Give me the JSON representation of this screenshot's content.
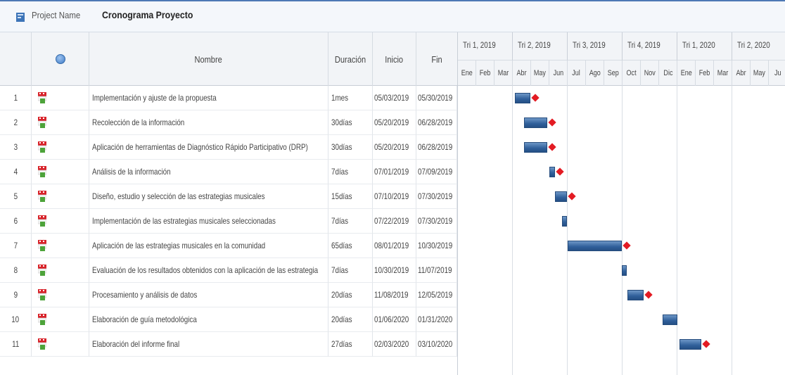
{
  "header": {
    "project_label": "Project Name",
    "project_name": "Cronograma Proyecto"
  },
  "columns": {
    "info": "info",
    "name": "Nombre",
    "duration": "Duración",
    "start": "Inicio",
    "end": "Fin"
  },
  "quarters": [
    "Tri 1, 2019",
    "Tri 2, 2019",
    "Tri 3, 2019",
    "Tri 4, 2019",
    "Tri 1, 2020",
    "Tri 2, 2020"
  ],
  "months": [
    "Ene",
    "Feb",
    "Mar",
    "Abr",
    "May",
    "Jun",
    "Jul",
    "Ago",
    "Sep",
    "Oct",
    "Nov",
    "Dic",
    "Ene",
    "Feb",
    "Mar",
    "Abr",
    "May",
    "Ju"
  ],
  "tasks": [
    {
      "id": "1",
      "name": "Implementación y ajuste de la propuesta",
      "duration": "1mes",
      "start": "05/03/2019",
      "end": "05/30/2019"
    },
    {
      "id": "2",
      "name": "Recolección de la información",
      "duration": "30días",
      "start": "05/20/2019",
      "end": "06/28/2019"
    },
    {
      "id": "3",
      "name": "Aplicación de herramientas de Diagnóstico Rápido Participativo (DRP)",
      "duration": "30días",
      "start": "05/20/2019",
      "end": "06/28/2019"
    },
    {
      "id": "4",
      "name": "Análisis de la información",
      "duration": "7días",
      "start": "07/01/2019",
      "end": "07/09/2019"
    },
    {
      "id": "5",
      "name": "Diseño, estudio y selección de las estrategias musicales",
      "duration": "15días",
      "start": "07/10/2019",
      "end": "07/30/2019"
    },
    {
      "id": "6",
      "name": "Implementación de las estrategias musicales seleccionadas",
      "duration": "7días",
      "start": "07/22/2019",
      "end": "07/30/2019"
    },
    {
      "id": "7",
      "name": "Aplicación de las estrategias musicales en la comunidad",
      "duration": "65días",
      "start": "08/01/2019",
      "end": "10/30/2019"
    },
    {
      "id": "8",
      "name": "Evaluación de los resultados obtenidos con la aplicación de las estrategia",
      "duration": "7días",
      "start": "10/30/2019",
      "end": "11/07/2019"
    },
    {
      "id": "9",
      "name": "Procesamiento y análisis de datos",
      "duration": "20días",
      "start": "11/08/2019",
      "end": "12/05/2019"
    },
    {
      "id": "10",
      "name": "Elaboración de guía metodológica",
      "duration": "20días",
      "start": "01/06/2020",
      "end": "01/31/2020"
    },
    {
      "id": "11",
      "name": "Elaboración del informe final",
      "duration": "27días",
      "start": "02/03/2020",
      "end": "03/10/2020"
    }
  ],
  "bars": [
    {
      "task": "1",
      "start_month": 4.1,
      "end_month": 4.95,
      "milestone": true
    },
    {
      "task": "2",
      "start_month": 4.6,
      "end_month": 5.9,
      "milestone": true
    },
    {
      "task": "3",
      "start_month": 4.6,
      "end_month": 5.9,
      "milestone": true
    },
    {
      "task": "4",
      "start_month": 6.0,
      "end_month": 6.3,
      "milestone": true
    },
    {
      "task": "5",
      "start_month": 6.3,
      "end_month": 6.95,
      "milestone": true
    },
    {
      "task": "6",
      "start_month": 6.7,
      "end_month": 6.95,
      "milestone": false
    },
    {
      "task": "7",
      "start_month": 7.0,
      "end_month": 9.95,
      "milestone": true
    },
    {
      "task": "8",
      "start_month": 9.95,
      "end_month": 10.25,
      "milestone": false
    },
    {
      "task": "9",
      "start_month": 10.25,
      "end_month": 11.15,
      "milestone": true
    },
    {
      "task": "10",
      "start_month": 12.2,
      "end_month": 13.0,
      "milestone": false
    },
    {
      "task": "11",
      "start_month": 13.1,
      "end_month": 14.3,
      "milestone": true
    }
  ],
  "colors": {
    "bar": "#3a6aa5",
    "milestone": "#e31b23",
    "header_bg": "#f2f4f7"
  }
}
